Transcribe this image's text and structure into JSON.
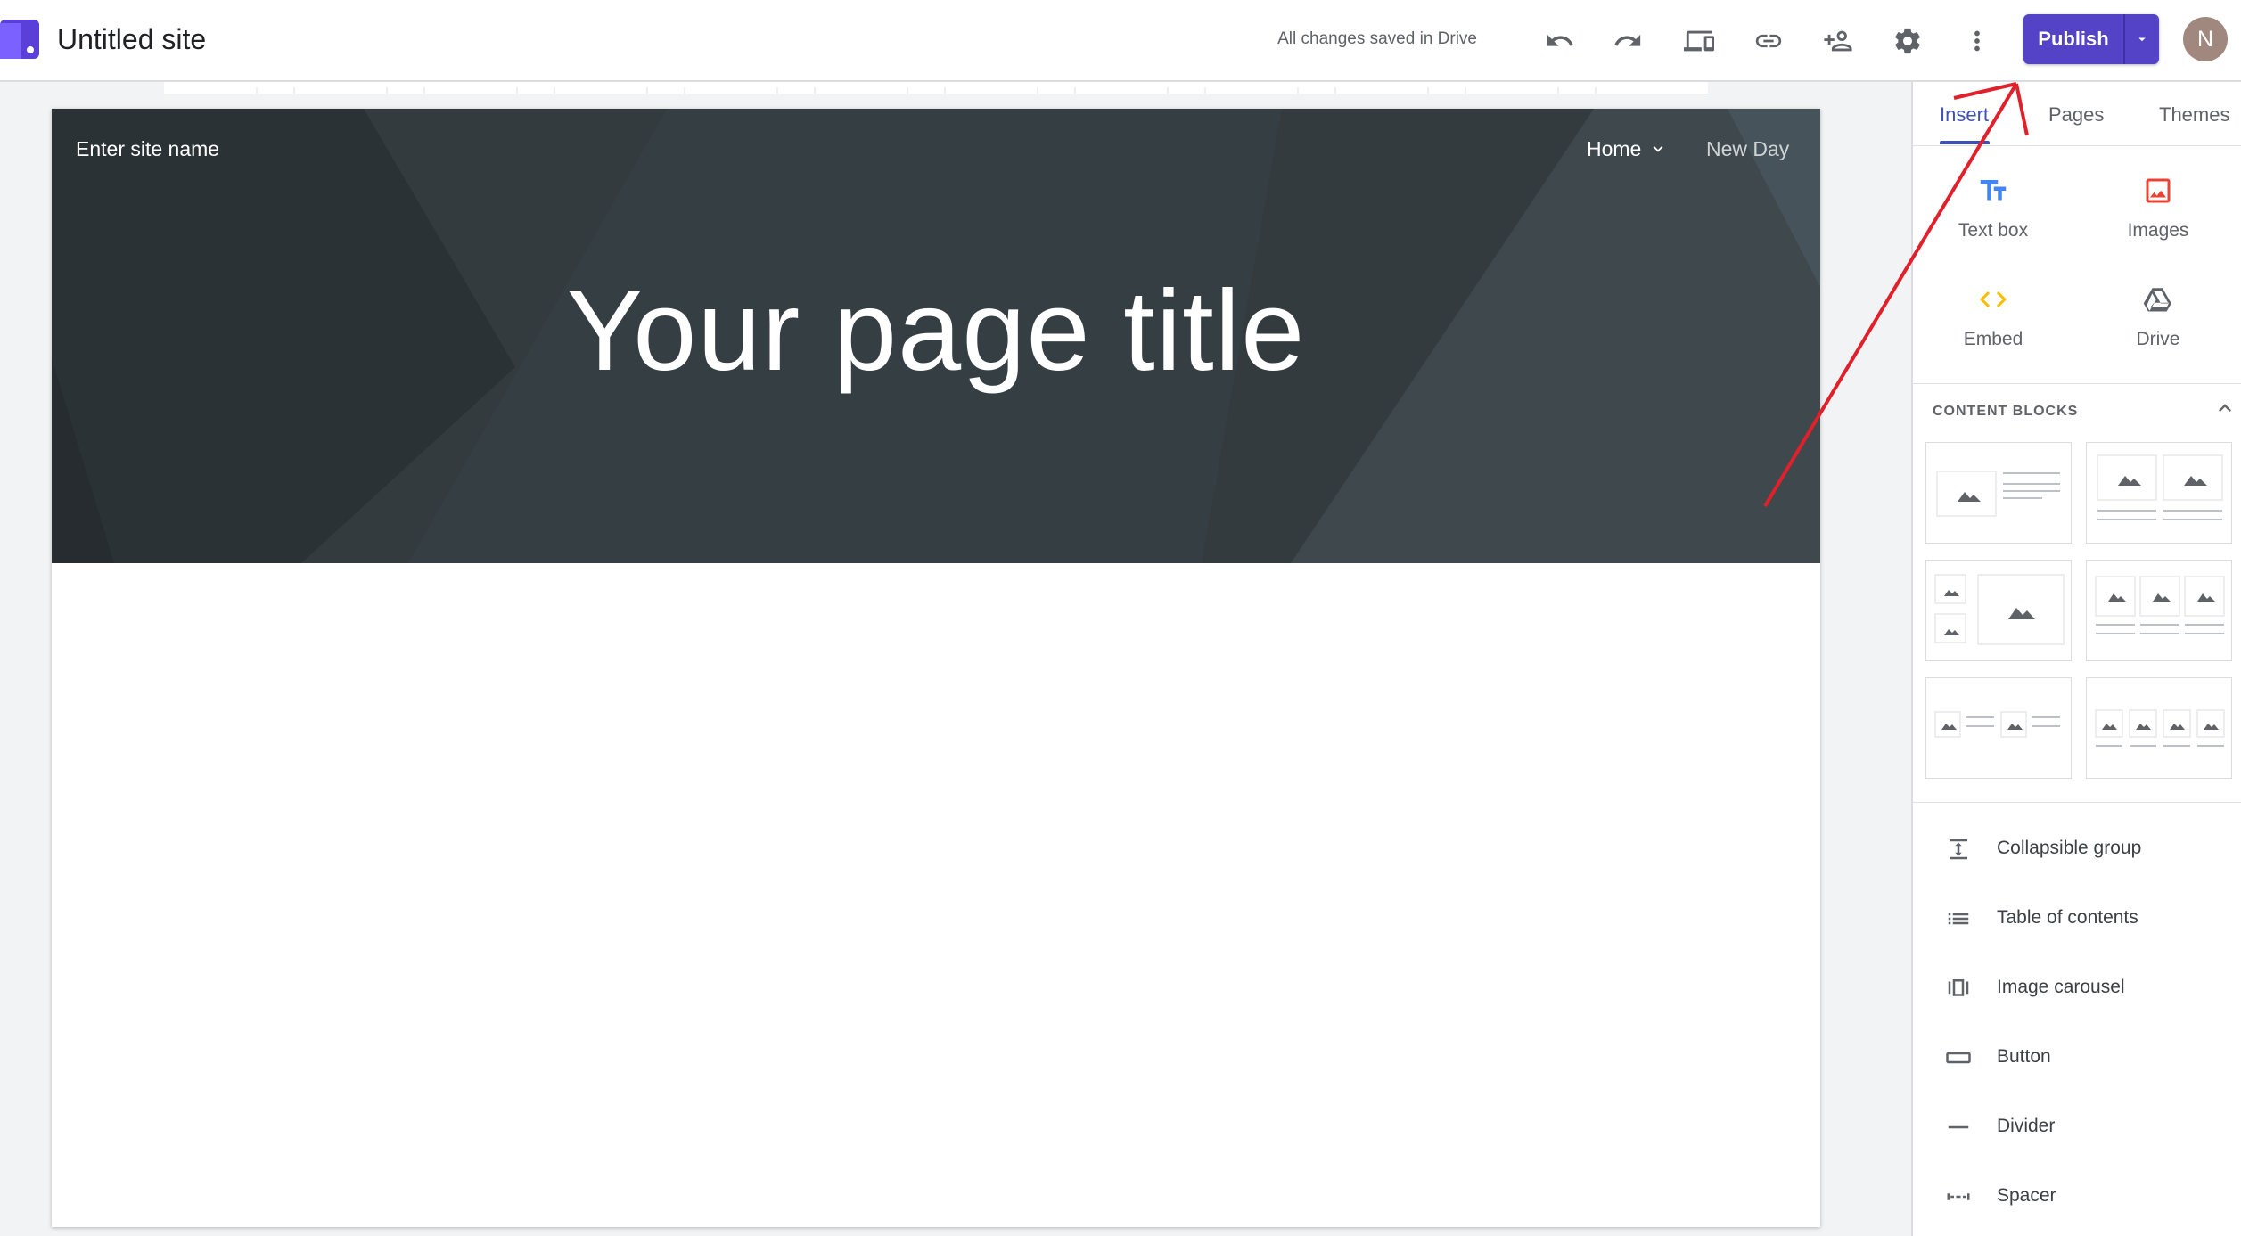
{
  "window": {
    "title": "Untitled site",
    "save_status": "All changes saved in Drive"
  },
  "toolbar": {
    "icons": [
      "undo-icon",
      "redo-icon",
      "preview-devices-icon",
      "link-icon",
      "share-icon",
      "settings-icon",
      "more-vert-icon"
    ],
    "publish_label": "Publish"
  },
  "user": {
    "avatar_initial": "N",
    "avatar_color": "#a1887f"
  },
  "header": {
    "site_name": "Enter site name",
    "nav": {
      "home": "Home",
      "new_day": "New Day"
    },
    "page_title": "Your page title"
  },
  "panel": {
    "tabs": {
      "insert": "Insert",
      "pages": "Pages",
      "themes": "Themes"
    },
    "insert_items": {
      "text_box": "Text box",
      "images": "Images",
      "embed": "Embed",
      "drive": "Drive"
    },
    "content_blocks_title": "CONTENT BLOCKS",
    "list": {
      "collapsible_group": "Collapsible group",
      "table_of_contents": "Table of contents",
      "image_carousel": "Image carousel",
      "button": "Button",
      "divider": "Divider",
      "spacer": "Spacer"
    }
  },
  "colors": {
    "accent": "#5443c6",
    "tab_active": "#3f51b5",
    "header_bg": "#333b3f",
    "annotation": "#e0202b"
  }
}
